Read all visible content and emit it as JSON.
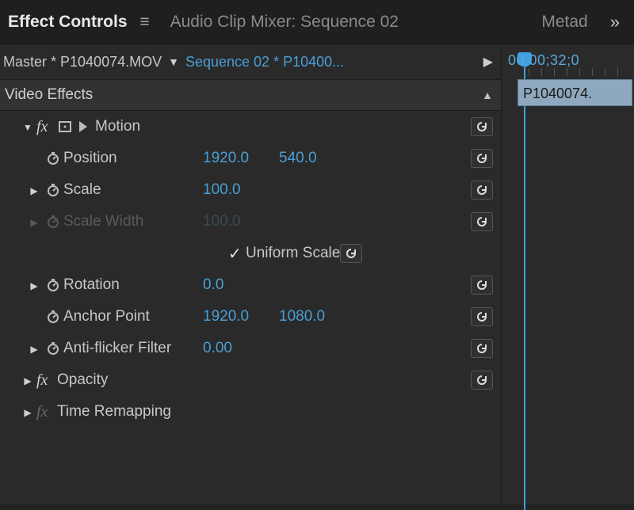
{
  "tabs": {
    "effect_controls": "Effect Controls",
    "audio_mixer": "Audio Clip Mixer: Sequence 02",
    "metadata": "Metad"
  },
  "source": {
    "master": "Master * P1040074.MOV",
    "sequence": "Sequence 02 * P10400..."
  },
  "section": {
    "video_effects": "Video Effects"
  },
  "motion": {
    "label": "Motion",
    "position": {
      "label": "Position",
      "x": "1920.0",
      "y": "540.0"
    },
    "scale": {
      "label": "Scale",
      "value": "100.0"
    },
    "scale_width": {
      "label": "Scale Width",
      "value": "100.0"
    },
    "uniform_scale": {
      "label": "Uniform Scale",
      "checked": true
    },
    "rotation": {
      "label": "Rotation",
      "value": "0.0"
    },
    "anchor": {
      "label": "Anchor Point",
      "x": "1920.0",
      "y": "1080.0"
    },
    "anti_flicker": {
      "label": "Anti-flicker Filter",
      "value": "0.00"
    }
  },
  "opacity": {
    "label": "Opacity"
  },
  "time_remap": {
    "label": "Time Remapping"
  },
  "timeline": {
    "timecode": "00;00;32;0",
    "clip_name": "P1040074."
  }
}
